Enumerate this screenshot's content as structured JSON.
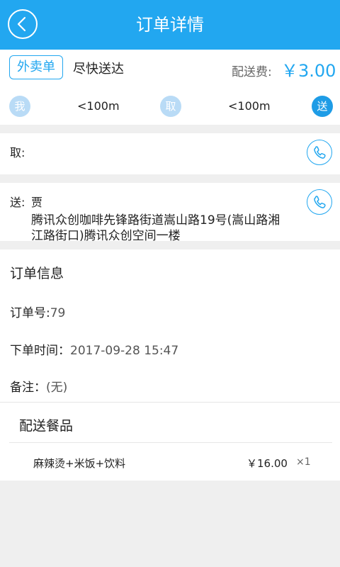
{
  "header": {
    "title": "订单详情"
  },
  "order": {
    "type_label": "外卖单",
    "delivery_mode": "尽快送达",
    "fee_label": "配送费:",
    "fee_value": "￥3.00"
  },
  "route": {
    "me_badge": "我",
    "dist1": "<100m",
    "pickup_badge": "取",
    "dist2": "<100m",
    "deliver_badge": "送"
  },
  "pickup": {
    "label": "取:"
  },
  "delivery": {
    "label": "送:",
    "name": "贾",
    "address_line1": "腾讯众创咖啡先锋路街道嵩山路19号(嵩山路湘",
    "address_line2": "江路街口)腾讯众创空间一楼"
  },
  "info": {
    "title": "订单信息",
    "order_no_label": "订单号:",
    "order_no": "79",
    "time_label": "下单时间：",
    "time_value": "2017-09-28 15:47",
    "note_label": "备注：",
    "note_value": "(无)"
  },
  "meals": {
    "title": "配送餐品",
    "items": [
      {
        "name": "麻辣烫+米饭+饮料",
        "price": "￥16.00",
        "qty": "×1"
      }
    ]
  },
  "colors": {
    "accent": "#22a7f0",
    "badge_light": "#b9dbf6",
    "background": "#efefef"
  }
}
